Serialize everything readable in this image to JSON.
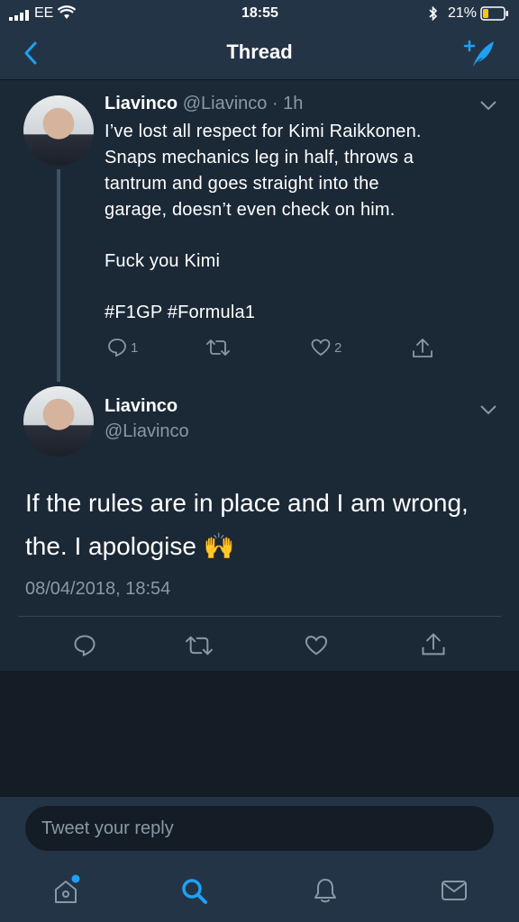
{
  "status_bar": {
    "carrier": "EE",
    "time": "18:55",
    "battery": "21%"
  },
  "header": {
    "title": "Thread"
  },
  "tweet1": {
    "name": "Liavinco",
    "handle_time": "@Liavinco · 1h",
    "lines": [
      "I’ve lost all respect for Kimi Raikkonen.",
      "Snaps mechanics leg in half, throws a",
      "tantrum and goes straight into the",
      "garage, doesn’t even check on him."
    ],
    "line2": "Fuck you Kimi",
    "hashtags": "#F1GP #Formula1",
    "reply_count": "1",
    "like_count": "2"
  },
  "tweet2": {
    "name": "Liavinco",
    "handle": "@Liavinco",
    "line1": "If the rules are in place and I am wrong,",
    "line2": "the. I apologise 🙌",
    "timestamp": "08/04/2018, 18:54"
  },
  "reply": {
    "placeholder": "Tweet your reply"
  },
  "icons": [
    "back-icon",
    "compose-icon",
    "chevron-down-icon",
    "reply-icon",
    "retweet-icon",
    "like-icon",
    "share-icon",
    "home-icon",
    "search-icon",
    "notifications-icon",
    "messages-icon"
  ],
  "colors": {
    "accent": "#1da1f2",
    "link": "#4aa3df",
    "muted": "#8899a6",
    "background": "#1b2836",
    "bar": "#243447"
  }
}
